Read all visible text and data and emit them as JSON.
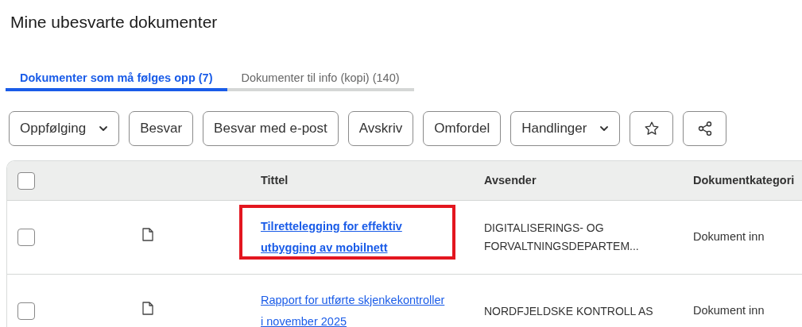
{
  "page_title": "Mine ubesvarte dokumenter",
  "tabs": [
    {
      "label": "Dokumenter som må følges opp (7)",
      "selected": true
    },
    {
      "label": "Dokumenter til info (kopi) (140)",
      "selected": false
    }
  ],
  "toolbar": [
    {
      "kind": "dropdown",
      "label": "Oppfølging"
    },
    {
      "kind": "text",
      "label": "Besvar"
    },
    {
      "kind": "text",
      "label": "Besvar med e-post"
    },
    {
      "kind": "text",
      "label": "Avskriv"
    },
    {
      "kind": "text",
      "label": "Omfordel"
    },
    {
      "kind": "dropdown",
      "label": "Handlinger"
    },
    {
      "kind": "star"
    },
    {
      "kind": "share"
    }
  ],
  "table": {
    "select_all_checked": false,
    "columns": [
      "Tittel",
      "Avsender",
      "Dokumentkategori"
    ],
    "rows": [
      {
        "checked": false,
        "title": "Tilrettelegging for effektiv utbygging av mobilnett",
        "unread": true,
        "highlighted": true,
        "sender": "DIGITALISERINGS- OG FORVALTNINGSDEPARTEM...",
        "category": "Dokument inn"
      },
      {
        "checked": false,
        "title": "Rapport for utførte skjenkekontroller i november 2025",
        "unread": false,
        "highlighted": false,
        "sender": "NORDFJELDSKE KONTROLL AS",
        "category": "Dokument inn"
      }
    ]
  }
}
